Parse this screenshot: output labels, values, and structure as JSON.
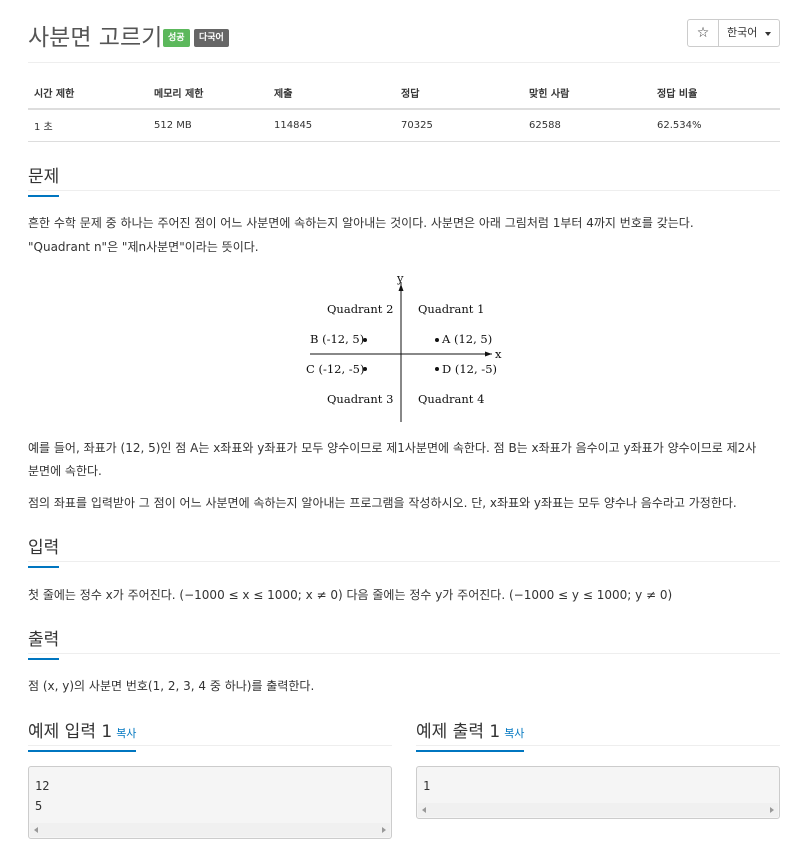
{
  "header": {
    "title": "사분면 고르기",
    "badge_status": "성공",
    "badge_language": "다국어",
    "star_icon": "☆",
    "language_button": "한국어"
  },
  "info_table": {
    "headers": [
      "시간 제한",
      "메모리 제한",
      "제출",
      "정답",
      "맞힌 사람",
      "정답 비율"
    ],
    "values": [
      "1 초",
      "512 MB",
      "114845",
      "70325",
      "62588",
      "62.534%"
    ]
  },
  "problem": {
    "heading": "문제",
    "line1": "흔한 수학 문제 중 하나는 주어진 점이 어느 사분면에 속하는지 알아내는 것이다. 사분면은 아래 그림처럼 1부터 4까지 번호를 갖는다.",
    "line2": "\"Quadrant n\"은 \"제n사분면\"이라는 뜻이다.",
    "figure": {
      "axis_x": "x",
      "axis_y": "y",
      "q2": "Quadrant 2",
      "q1": "Quadrant 1",
      "q3": "Quadrant 3",
      "q4": "Quadrant 4",
      "point_b": "B (-12, 5)",
      "point_a": "A (12, 5)",
      "point_c": "C (-12, -5)",
      "point_d": "D (12, -5)"
    },
    "line3": "예를 들어, 좌표가 (12, 5)인 점 A는 x좌표와 y좌표가 모두 양수이므로 제1사분면에 속한다. 점 B는 x좌표가 음수이고 y좌표가 양수이므로 제2사",
    "line4": "분면에 속한다.",
    "line5": "점의 좌표를 입력받아 그 점이 어느 사분면에 속하는지 알아내는 프로그램을 작성하시오. 단, x좌표와 y좌표는 모두 양수나 음수라고 가정한다."
  },
  "input": {
    "heading": "입력",
    "text": "첫 줄에는 정수 x가 주어진다. (−1000 ≤ x ≤ 1000; x ≠ 0) 다음 줄에는 정수 y가 주어진다. (−1000 ≤ y ≤ 1000; y ≠ 0)"
  },
  "output": {
    "heading": "출력",
    "text": "점 (x, y)의 사분면 번호(1, 2, 3, 4 중 하나)를 출력한다."
  },
  "sample_input": {
    "heading": "예제 입력 1",
    "copy": "복사",
    "line1": "12",
    "line2": "5"
  },
  "sample_output": {
    "heading": "예제 출력 1",
    "copy": "복사",
    "line1": "1"
  }
}
